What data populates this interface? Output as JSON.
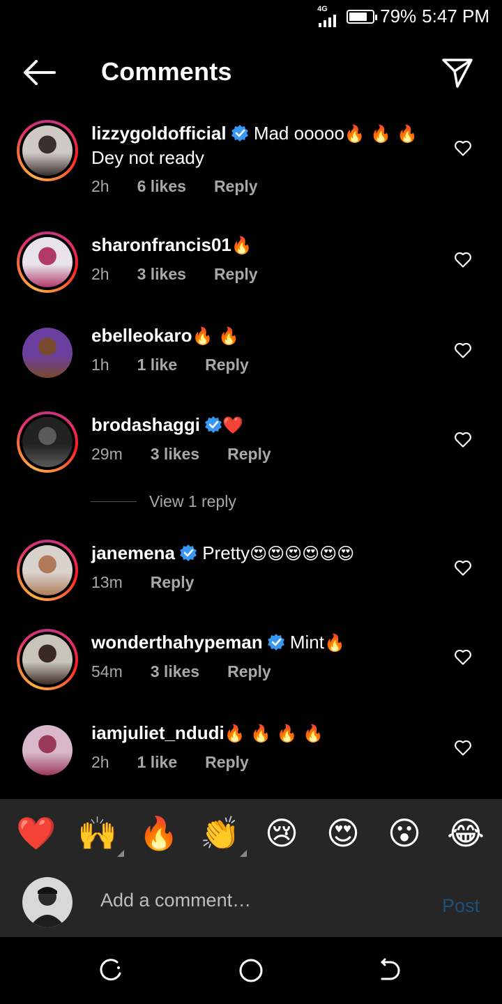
{
  "status_bar": {
    "network": "4G",
    "battery": "79%",
    "battery_level": 0.79,
    "time": "5:47 PM"
  },
  "header": {
    "title": "Comments",
    "back_icon": "back-arrow-icon",
    "share_icon": "send-icon"
  },
  "comments": [
    {
      "username": "lizzygoldofficial",
      "verified": true,
      "text_line1": "Mad ooooo",
      "emojis": "🔥 🔥 🔥",
      "text_line2": "Dey not ready",
      "time": "2h",
      "likes": "6 likes",
      "reply": "Reply",
      "ring": true,
      "avatar_colors": [
        "#cfc8c4",
        "#3a2f2f"
      ]
    },
    {
      "username": "sharonfrancis01",
      "verified": false,
      "text_line1": "",
      "emojis": "🔥",
      "time": "2h",
      "likes": "3 likes",
      "reply": "Reply",
      "ring": true,
      "avatar_colors": [
        "#e8e3ea",
        "#b23a6b"
      ]
    },
    {
      "username": "ebelleokaro",
      "verified": false,
      "text_line1": "",
      "emojis": "🔥 🔥",
      "time": "1h",
      "likes": "1 like",
      "reply": "Reply",
      "ring": false,
      "avatar_colors": [
        "#6b3fa0",
        "#7a4a2e"
      ]
    },
    {
      "username": "brodashaggi",
      "verified": true,
      "text_line1": "",
      "emojis": "❤️",
      "time": "29m",
      "likes": "3 likes",
      "reply": "Reply",
      "ring": true,
      "avatar_colors": [
        "#222222",
        "#5a5a5a"
      ]
    },
    {
      "username": "janemena",
      "verified": true,
      "text_line1": "Pretty",
      "emojis": "😍😍😍😍😍😍",
      "time": "13m",
      "likes": "",
      "reply": "Reply",
      "ring": true,
      "avatar_colors": [
        "#d9d2cc",
        "#b07a5a"
      ]
    },
    {
      "username": "wonderthahypeman",
      "verified": true,
      "text_line1": "Mint",
      "emojis": "🔥",
      "time": "54m",
      "likes": "3 likes",
      "reply": "Reply",
      "ring": true,
      "avatar_colors": [
        "#c9c4b8",
        "#3b2a22"
      ]
    },
    {
      "username": "iamjuliet_ndudi",
      "verified": false,
      "text_line1": "",
      "emojis": "🔥 🔥 🔥 🔥",
      "time": "2h",
      "likes": "1 like",
      "reply": "Reply",
      "ring": false,
      "avatar_colors": [
        "#d7b7c9",
        "#9a3a5a"
      ]
    }
  ],
  "view_replies": "View 1 reply",
  "reactions": [
    {
      "emoji": "❤️",
      "name": "heart",
      "has_menu": false
    },
    {
      "emoji": "🙌",
      "name": "raising-hands",
      "has_menu": true
    },
    {
      "emoji": "🔥",
      "name": "fire",
      "has_menu": false
    },
    {
      "emoji": "👏",
      "name": "clapping-hands",
      "has_menu": true
    },
    {
      "emoji": "😢",
      "name": "crying-face",
      "has_menu": false
    },
    {
      "emoji": "😍",
      "name": "heart-eyes",
      "has_menu": false
    },
    {
      "emoji": "😮",
      "name": "surprised-face",
      "has_menu": false
    },
    {
      "emoji": "😂",
      "name": "tears-of-joy",
      "has_menu": false
    }
  ],
  "composer": {
    "placeholder": "Add a comment…",
    "post_label": "Post"
  },
  "colors": {
    "background": "#000000",
    "panel": "#262626",
    "muted": "#a8a8a8",
    "verified": "#3897f0",
    "post_disabled": "#1d4f7a"
  }
}
